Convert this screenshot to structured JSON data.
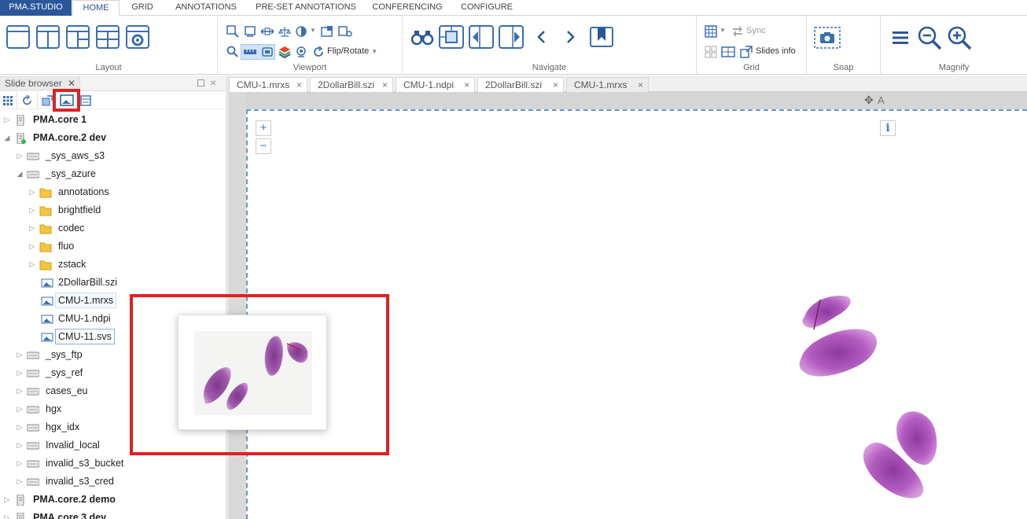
{
  "ribbon_tabs": {
    "app": "PMA.STUDIO",
    "items": [
      "HOME",
      "GRID",
      "ANNOTATIONS",
      "PRE-SET ANNOTATIONS",
      "CONFERENCING",
      "CONFIGURE"
    ],
    "active": "HOME"
  },
  "ribbon_groups": {
    "layout": "Layout",
    "viewport": "Viewport",
    "navigate": "Navigate",
    "grid": "Grid",
    "snap": "Snap",
    "magnify": "Magnify"
  },
  "viewport_tools": {
    "flip_rotate": "Flip/Rotate"
  },
  "grid_tools": {
    "sync": "Sync",
    "slides_info": "Slides info"
  },
  "slide_browser": {
    "title": "Slide browser",
    "tree": [
      {
        "label": "PMA.core 1",
        "level": 0,
        "bold": true,
        "expanded": false,
        "type": "server"
      },
      {
        "label": "PMA.core.2 dev",
        "level": 0,
        "bold": true,
        "expanded": true,
        "type": "server-online"
      },
      {
        "label": "_sys_aws_s3",
        "level": 1,
        "expanded": false,
        "type": "drive"
      },
      {
        "label": "_sys_azure",
        "level": 1,
        "expanded": true,
        "type": "drive"
      },
      {
        "label": "annotations",
        "level": 2,
        "expanded": false,
        "type": "folder"
      },
      {
        "label": "brightfield",
        "level": 2,
        "expanded": false,
        "type": "folder"
      },
      {
        "label": "codec",
        "level": 2,
        "expanded": false,
        "type": "folder"
      },
      {
        "label": "fluo",
        "level": 2,
        "expanded": false,
        "type": "folder"
      },
      {
        "label": "zstack",
        "level": 2,
        "expanded": false,
        "type": "folder"
      },
      {
        "label": "2DollarBill.szi",
        "level": 2,
        "type": "slide"
      },
      {
        "label": "CMU-1.mrxs",
        "level": 2,
        "type": "slide",
        "highlight": true
      },
      {
        "label": "CMU-1.ndpi",
        "level": 2,
        "type": "slide"
      },
      {
        "label": "CMU-11.svs",
        "level": 2,
        "type": "slide",
        "selected": true
      },
      {
        "label": "_sys_ftp",
        "level": 1,
        "expanded": false,
        "type": "drive"
      },
      {
        "label": "_sys_ref",
        "level": 1,
        "expanded": false,
        "type": "drive"
      },
      {
        "label": "cases_eu",
        "level": 1,
        "expanded": false,
        "type": "drive"
      },
      {
        "label": "hgx",
        "level": 1,
        "expanded": false,
        "type": "drive"
      },
      {
        "label": "hgx_idx",
        "level": 1,
        "expanded": false,
        "type": "drive"
      },
      {
        "label": "Invalid_local",
        "level": 1,
        "expanded": false,
        "type": "drive"
      },
      {
        "label": "invalid_s3_bucket",
        "level": 1,
        "expanded": false,
        "type": "drive"
      },
      {
        "label": "invalid_s3_cred",
        "level": 1,
        "expanded": false,
        "type": "drive"
      },
      {
        "label": "PMA.core.2 demo",
        "level": 0,
        "bold": true,
        "expanded": false,
        "type": "server"
      },
      {
        "label": "PMA.core 3 dev",
        "level": 0,
        "bold": true,
        "expanded": false,
        "type": "server"
      }
    ]
  },
  "doc_tabs": [
    {
      "label": "CMU-1.mrxs",
      "active": false
    },
    {
      "label": "2DollarBill.szi",
      "active": false
    },
    {
      "label": "CMU-1.ndpi",
      "active": false
    },
    {
      "label": "2DollarBill.szi",
      "active": false
    },
    {
      "label": "CMU-1.mrxs",
      "active": true
    }
  ],
  "viewer": {
    "zoom_in": "+",
    "zoom_out": "−",
    "info": "i",
    "pan_label": "A"
  },
  "colors": {
    "brand": "#2b579a",
    "highlight_red": "#e02020",
    "tissue": "#b05ab8",
    "viewport_border": "#5b9bd5"
  }
}
